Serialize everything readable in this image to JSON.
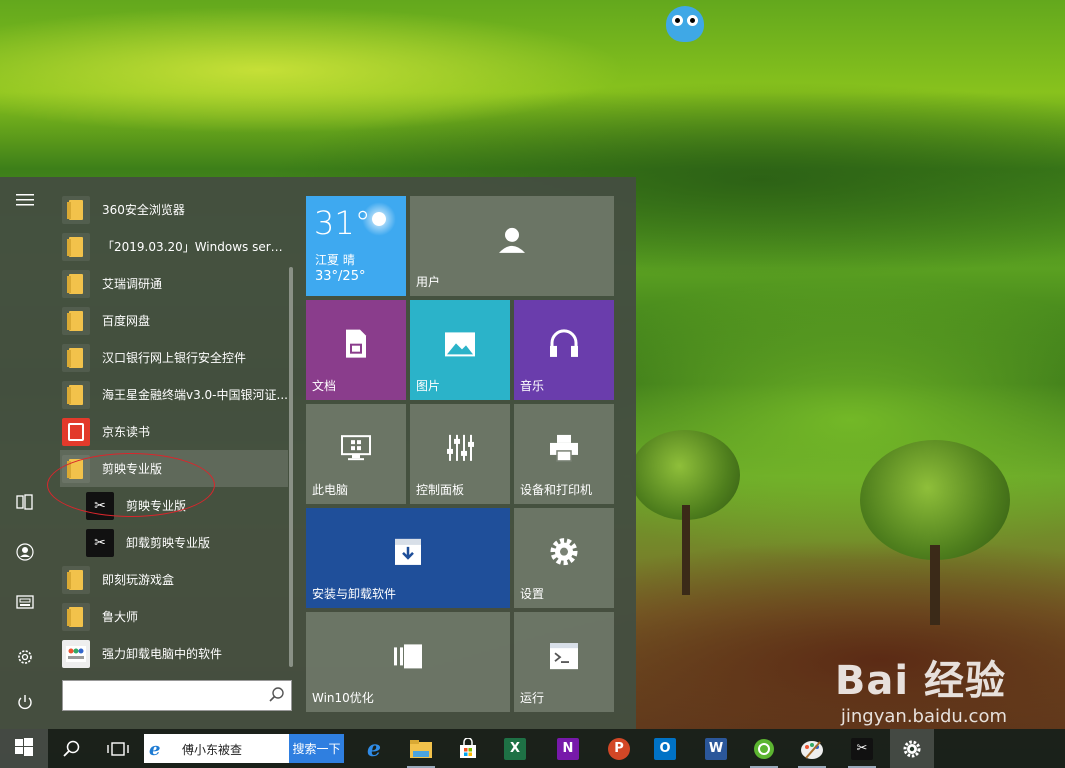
{
  "start_menu": {
    "rail": {
      "items": [
        "menu-icon",
        "document-icon",
        "user-icon",
        "pictures-icon",
        "settings-icon",
        "power-icon"
      ]
    },
    "apps": [
      {
        "label": "360安全浏览器",
        "icon": "folder-icon",
        "type": "folder"
      },
      {
        "label": "「2019.03.20」Windows serve...",
        "icon": "folder-icon",
        "type": "folder"
      },
      {
        "label": "艾瑞调研通",
        "icon": "folder-icon",
        "type": "folder"
      },
      {
        "label": "百度网盘",
        "icon": "folder-icon",
        "type": "folder"
      },
      {
        "label": "汉口银行网上银行安全控件",
        "icon": "folder-icon",
        "type": "folder"
      },
      {
        "label": "海王星金融终端v3.0-中国银河证...",
        "icon": "folder-icon",
        "type": "folder"
      },
      {
        "label": "京东读书",
        "icon": "jd-icon",
        "type": "app"
      },
      {
        "label": "剪映专业版",
        "icon": "folder-icon",
        "type": "folder",
        "selected": true
      },
      {
        "label": "剪映专业版",
        "icon": "capcut-icon",
        "type": "sub"
      },
      {
        "label": "卸载剪映专业版",
        "icon": "capcut-icon",
        "type": "sub"
      },
      {
        "label": "即刻玩游戏盒",
        "icon": "folder-icon",
        "type": "folder"
      },
      {
        "label": "鲁大师",
        "icon": "folder-icon",
        "type": "folder"
      },
      {
        "label": "强力卸载电脑中的软件",
        "icon": "uninstall-icon",
        "type": "app"
      }
    ],
    "search_placeholder": "",
    "tiles": {
      "weather": {
        "temp": "31°",
        "location": "江夏 晴",
        "range": "33°/25°",
        "color": "#3ea9f0"
      },
      "user": {
        "label": "用户"
      },
      "documents": {
        "label": "文档",
        "color": "#8a3d8c"
      },
      "pictures": {
        "label": "图片",
        "color": "#2bb3c9"
      },
      "music": {
        "label": "音乐",
        "color": "#6a3dac"
      },
      "this_pc": {
        "label": "此电脑"
      },
      "control_panel": {
        "label": "控制面板"
      },
      "devices_printers": {
        "label": "设备和打印机"
      },
      "install_uninstall": {
        "label": "安装与卸载软件",
        "color": "#1f4f9a"
      },
      "settings": {
        "label": "设置"
      },
      "win10_optimize": {
        "label": "Win10优化"
      },
      "run": {
        "label": "运行"
      }
    }
  },
  "taskbar": {
    "search_query": "傅小东被查",
    "search_button": "搜索一下",
    "apps": [
      "edge-icon",
      "file-explorer-icon",
      "store-icon",
      "excel-icon",
      "onenote-icon",
      "powerpoint-icon",
      "outlook-icon",
      "word-icon",
      "browser-360-icon",
      "paint-icon",
      "capcut-icon",
      "settings-icon"
    ]
  },
  "watermark": {
    "logo": "Bai 经验",
    "url": "jingyan.baidu.com"
  }
}
